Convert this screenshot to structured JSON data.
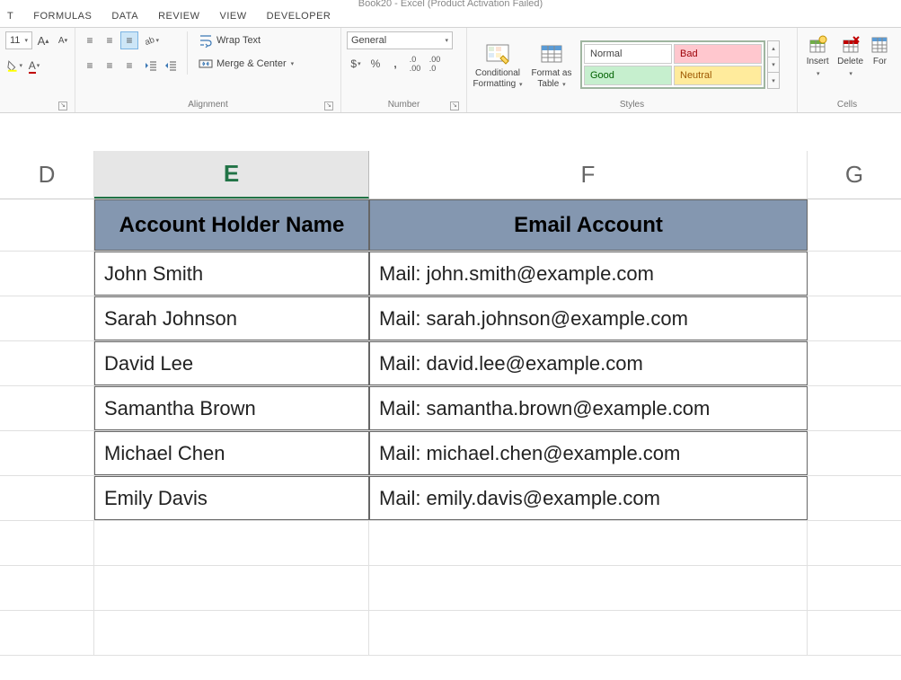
{
  "title": "Book20 - Excel (Product Activation Failed)",
  "tabs": [
    "T",
    "FORMULAS",
    "DATA",
    "REVIEW",
    "VIEW",
    "DEVELOPER"
  ],
  "font": {
    "size": "11",
    "incA": "A",
    "decA": "A"
  },
  "alignment": {
    "wrap": "Wrap Text",
    "merge": "Merge & Center",
    "group": "Alignment"
  },
  "number": {
    "format": "General",
    "group": "Number"
  },
  "styles": {
    "cond": "Conditional Formatting",
    "fmtTable": "Format as Table",
    "cells": {
      "normal": "Normal",
      "bad": "Bad",
      "good": "Good",
      "neutral": "Neutral"
    },
    "group": "Styles"
  },
  "cells": {
    "insert": "Insert",
    "delete": "Delete",
    "format": "For",
    "group": "Cells"
  },
  "columns": {
    "d": "D",
    "e": "E",
    "f": "F",
    "g": "G"
  },
  "table": {
    "headers": {
      "name": "Account Holder Name",
      "email": "Email Account"
    },
    "rows": [
      {
        "name": "John Smith",
        "email": "Mail: john.smith@example.com"
      },
      {
        "name": "Sarah Johnson",
        "email": "Mail: sarah.johnson@example.com"
      },
      {
        "name": "David Lee",
        "email": "Mail: david.lee@example.com"
      },
      {
        "name": "Samantha Brown",
        "email": "Mail: samantha.brown@example.com"
      },
      {
        "name": "Michael Chen",
        "email": "Mail: michael.chen@example.com"
      },
      {
        "name": "Emily Davis",
        "email": "Mail: emily.davis@example.com"
      }
    ]
  }
}
